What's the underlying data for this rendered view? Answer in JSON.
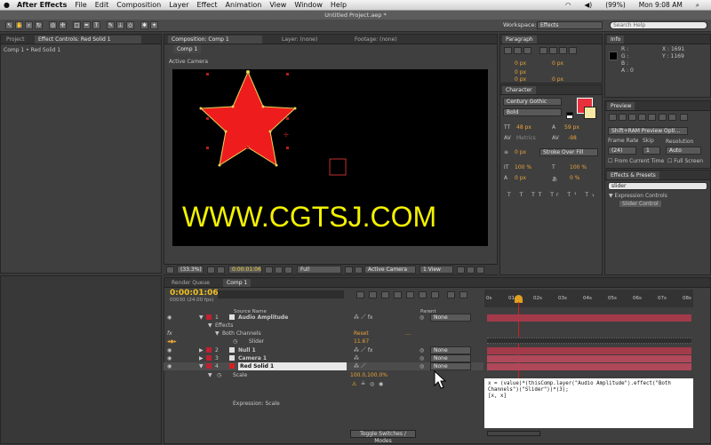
{
  "menubar": {
    "app_name": "After Effects",
    "items": [
      "File",
      "Edit",
      "Composition",
      "Layer",
      "Effect",
      "Animation",
      "View",
      "Window",
      "Help"
    ],
    "status": {
      "battery": "(99%)",
      "time": "Mon 9:08 AM"
    }
  },
  "window": {
    "title": "Untitled Project.aep *"
  },
  "toolbar": {
    "workspace_label": "Workspace:",
    "workspace_value": "Effects",
    "search_placeholder": "Search Help"
  },
  "project_panel": {
    "tab_project": "Project",
    "tab_effect_controls": "Effect Controls: Red Solid 1",
    "breadcrumb": "Comp 1 • Red Solid 1"
  },
  "comp_panel": {
    "tab_comp": "Composition: Comp 1",
    "tab_layer": "Layer: (none)",
    "tab_footage": "Footage: (none)",
    "subtab": "Comp 1",
    "view_label": "Active Camera",
    "zoom": "(33.3%)",
    "timecode": "0:00:01:06",
    "resolution": "Full",
    "camera": "Active Camera",
    "views": "1 View"
  },
  "watermark": "WWW.CGTSJ.COM",
  "info_panel": {
    "title": "Info",
    "r": "R :",
    "g": "G :",
    "b": "B :",
    "a": "A : 0",
    "x": "X : 1691",
    "y": "Y : 1169"
  },
  "paragraph_panel": {
    "title": "Paragraph",
    "indent1": "0 px",
    "indent2": "0 px",
    "indent3": "0 px",
    "space1": "0 px",
    "space2": "0 px"
  },
  "character_panel": {
    "title": "Character",
    "font": "Century Gothic",
    "style": "Bold",
    "size": "48 px",
    "leading": "59 px",
    "kerning": "Metrics",
    "tracking": "-98",
    "stroke_width": "0 px",
    "stroke_type": "Stroke Over Fill",
    "vscale": "100 %",
    "hscale": "100 %",
    "baseline": "0 px",
    "tsume": "0 %",
    "fill_color": "#e8313c",
    "stroke_color": "#f6e9a3"
  },
  "preview_panel": {
    "title": "Preview",
    "mode": "Shift+RAM Preview Opti...",
    "frame_rate_label": "Frame Rate",
    "frame_rate": "(24)",
    "skip_label": "Skip",
    "skip": "1",
    "resolution_label": "Resolution",
    "resolution": "Auto",
    "from_current": "From Current Time",
    "full_screen": "Full Screen"
  },
  "effects_presets": {
    "title": "Effects & Presets",
    "search_value": "slider",
    "category": "Expression Controls",
    "item": "Slider Control"
  },
  "timeline": {
    "tab_render": "Render Queue",
    "tab_comp": "Comp 1",
    "timecode": "0:00:01:06",
    "frames": "00030 (24.00 fps)",
    "col_source": "Source Name",
    "col_parent": "Parent",
    "ruler": [
      "0s",
      "01s",
      "02s",
      "03s",
      "04s",
      "05s",
      "06s",
      "07s",
      "08s"
    ],
    "layers": [
      {
        "num": "1",
        "name": "Audio Amplitude",
        "parent": "None",
        "color": "#e0e0e0"
      },
      {
        "num": "2",
        "name": "Null 1",
        "parent": "None",
        "color": "#e0e0e0"
      },
      {
        "num": "3",
        "name": "Camera 1",
        "parent": "None",
        "color": "#e0e0e0"
      },
      {
        "num": "4",
        "name": "Red Solid 1",
        "parent": "None",
        "color": "#d62020"
      }
    ],
    "effects_label": "Effects",
    "both_channels": "Both Channels",
    "reset": "Reset",
    "slider_label": "Slider",
    "slider_value": "11.67",
    "scale_label": "Scale",
    "scale_value": "100.0,100.0%",
    "expression_label": "Expression: Scale",
    "expression_text": "x = (value)*(thisComp.layer(\"Audio Amplitude\").effect(\"Both Channels\")(\"Slider\"))*(3);\n[x, x]",
    "toggle_modes": "Toggle Switches / Modes"
  }
}
